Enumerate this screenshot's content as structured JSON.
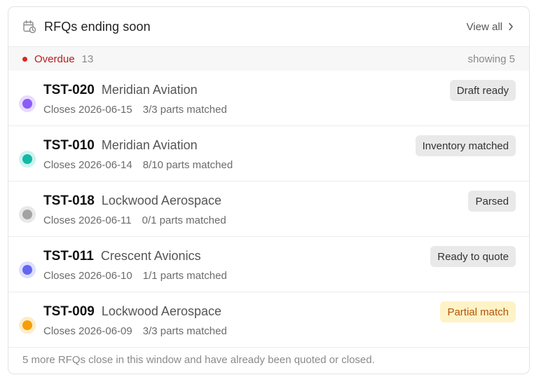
{
  "header": {
    "icon": "calendar-clock-icon",
    "title": "RFQs ending soon",
    "view_all_label": "View all",
    "chevron_icon": "chevron-right-icon"
  },
  "section": {
    "label": "Overdue",
    "count": "13",
    "showing": "showing 5",
    "dot_color": "#dc2626"
  },
  "rows": [
    {
      "id": "TST-020",
      "customer": "Meridian Aviation",
      "closes": "Closes 2026-06-15",
      "parts": "3/3 parts matched",
      "status": "Draft ready",
      "avatar_color": "#8b5cf6",
      "avatar_ring": "#e6dcfd"
    },
    {
      "id": "TST-010",
      "customer": "Meridian Aviation",
      "closes": "Closes 2026-06-14",
      "parts": "8/10 parts matched",
      "status": "Inventory matched",
      "avatar_color": "#14b8a6",
      "avatar_ring": "#cdf3ee"
    },
    {
      "id": "TST-018",
      "customer": "Lockwood Aerospace",
      "closes": "Closes 2026-06-11",
      "parts": "0/1 parts matched",
      "status": "Parsed",
      "avatar_color": "#a3a3a3",
      "avatar_ring": "#e8e8e8"
    },
    {
      "id": "TST-011",
      "customer": "Crescent Avionics",
      "closes": "Closes 2026-06-10",
      "parts": "1/1 parts matched",
      "status": "Ready to quote",
      "avatar_color": "#6366f1",
      "avatar_ring": "#dedffd"
    },
    {
      "id": "TST-009",
      "customer": "Lockwood Aerospace",
      "closes": "Closes 2026-06-09",
      "parts": "3/3 parts matched",
      "status": "Partial match",
      "avatar_color": "#f59e0b",
      "avatar_ring": "#fdecc8"
    }
  ],
  "footer": {
    "text": "5 more RFQs close in this window and have already been quoted or closed."
  }
}
